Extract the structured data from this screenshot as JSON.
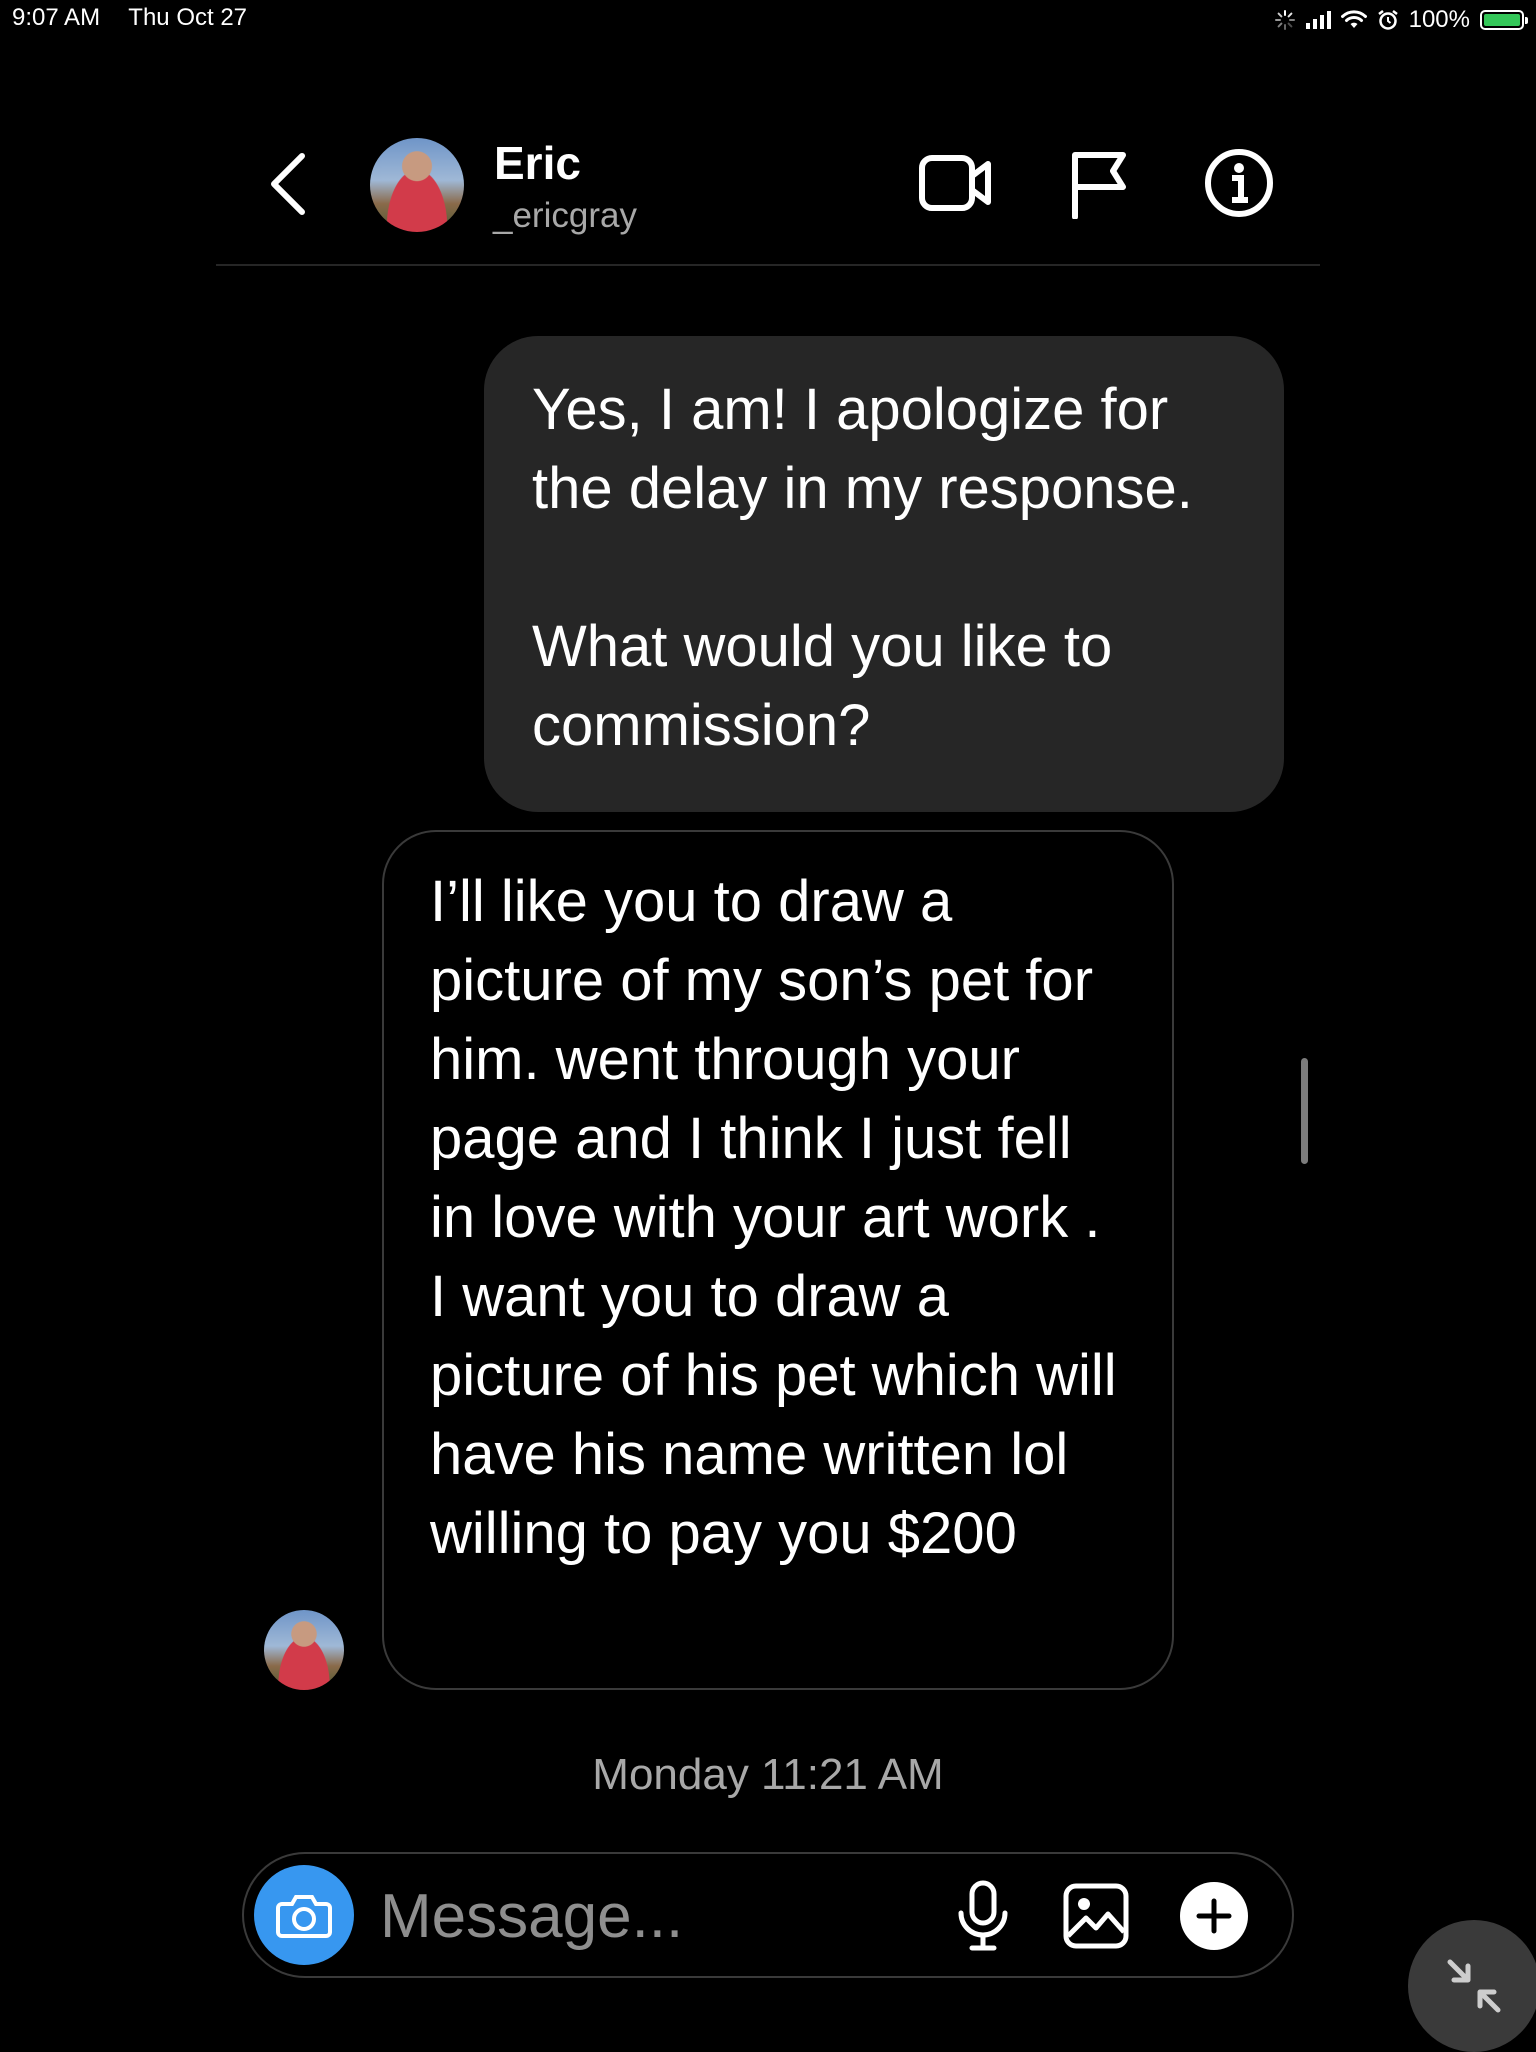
{
  "status_bar": {
    "time": "9:07 AM",
    "date": "Thu Oct 27",
    "battery": "100%",
    "battery_level": 1.0,
    "battery_color": "#34c759"
  },
  "header": {
    "name": "Eric",
    "username": "_ericgray",
    "back_icon": "chevron-left-icon",
    "video_icon": "video-camera-icon",
    "report_icon": "flag-icon",
    "info_icon": "info-icon"
  },
  "messages": [
    {
      "direction": "outgoing",
      "paragraphs": [
        "Yes, I am! I apologize for the delay in my response.",
        "What would you like to commission?"
      ]
    },
    {
      "direction": "incoming",
      "text": "I’ll like you to draw a picture of my son’s pet for him. went through your page and I think I just fell in love with your art work . I want you to draw a picture of his pet which will have his name written lol willing to pay you $200"
    }
  ],
  "timestamp": "Monday 11:21 AM",
  "composer": {
    "placeholder": "Message...",
    "camera_icon": "camera-icon",
    "mic_icon": "microphone-icon",
    "gallery_icon": "image-icon",
    "add_icon": "plus-icon",
    "accent": "#3797f0"
  },
  "floating_button_icon": "collapse-arrows-icon"
}
